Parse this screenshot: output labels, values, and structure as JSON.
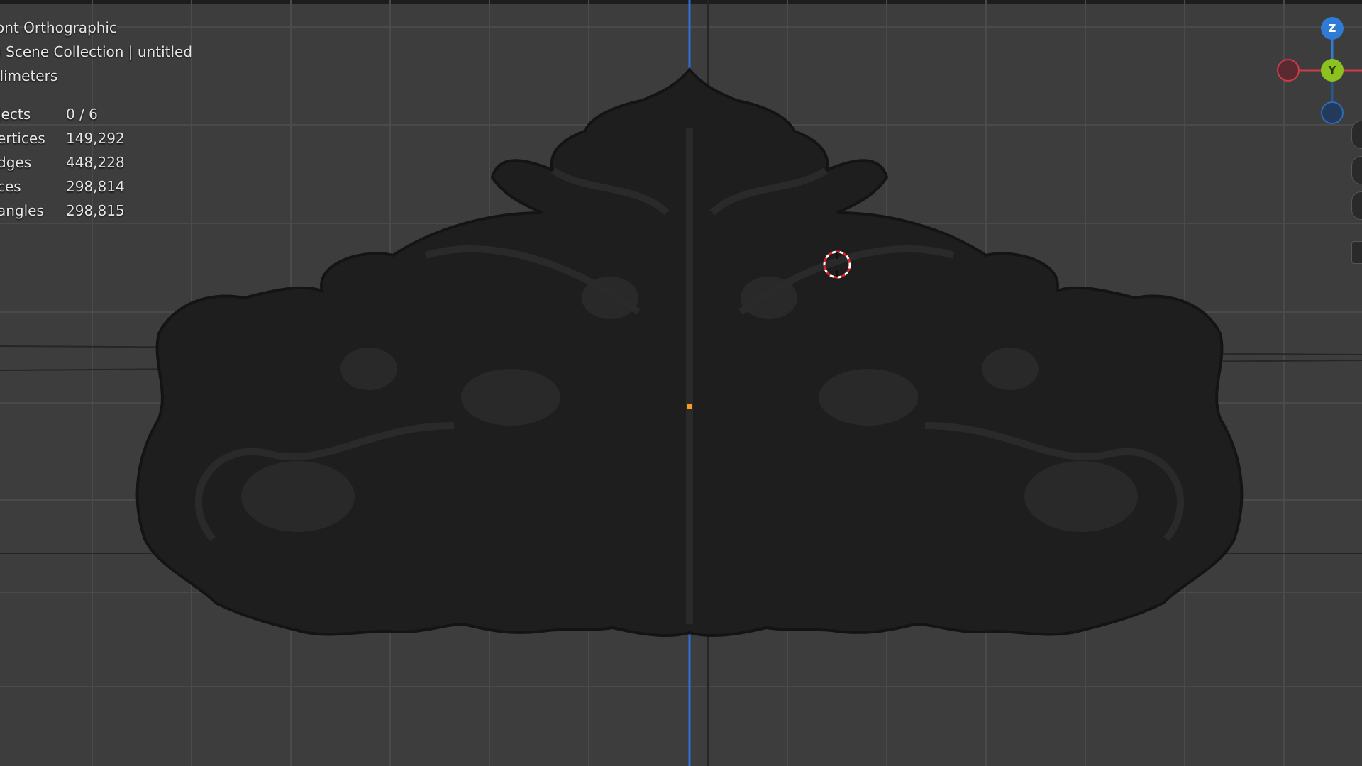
{
  "viewport": {
    "view_name": "ont Orthographic",
    "collection_line": ") Scene Collection | untitled",
    "units": "llimeters"
  },
  "stats": [
    {
      "label": "jects",
      "value": "0 / 6"
    },
    {
      "label": "ertices",
      "value": "149,292"
    },
    {
      "label": "dges",
      "value": "448,228"
    },
    {
      "label": "ces",
      "value": "298,814"
    },
    {
      "label": "angles",
      "value": "298,815"
    }
  ],
  "gizmo": {
    "z_label": "Z",
    "y_label": "Y",
    "colors": {
      "z": "#2f7bd6",
      "y": "#8cc21f",
      "x": "#d03a4a",
      "neg_z": "#29578f"
    }
  },
  "colors": {
    "background": "#3d3d3d",
    "grid": "#4c4c4c",
    "axis_z": "#2a6fd0",
    "object": "#1f1f1f",
    "origin": "#ff9a1a"
  }
}
